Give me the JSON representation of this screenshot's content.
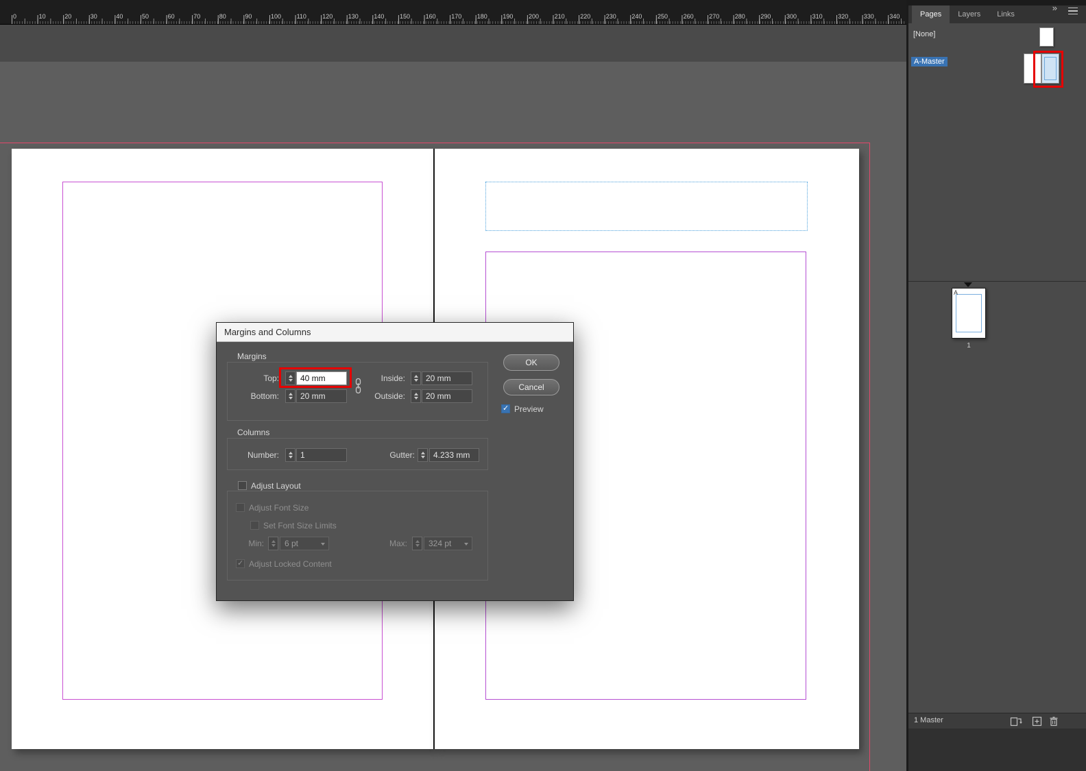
{
  "ruler": {
    "labels": [
      "0",
      "10",
      "20",
      "30",
      "40",
      "50",
      "60",
      "70",
      "80",
      "90",
      "100",
      "110",
      "120",
      "130",
      "140",
      "150",
      "160",
      "170",
      "180",
      "190",
      "200",
      "210",
      "220",
      "230",
      "240",
      "250",
      "260",
      "270",
      "280",
      "290",
      "300",
      "310",
      "320",
      "330",
      "340"
    ]
  },
  "dialog": {
    "title": "Margins and Columns",
    "buttons": {
      "ok": "OK",
      "cancel": "Cancel"
    },
    "preview_label": "Preview",
    "margins": {
      "legend": "Margins",
      "top": {
        "label": "Top:",
        "value": "40 mm"
      },
      "bottom": {
        "label": "Bottom:",
        "value": "20 mm"
      },
      "inside": {
        "label": "Inside:",
        "value": "20 mm"
      },
      "outside": {
        "label": "Outside:",
        "value": "20 mm"
      }
    },
    "columns": {
      "legend": "Columns",
      "number": {
        "label": "Number:",
        "value": "1"
      },
      "gutter": {
        "label": "Gutter:",
        "value": "4.233 mm"
      }
    },
    "adjust": {
      "legend": "Adjust Layout",
      "adjust_font_size": "Adjust Font Size",
      "set_font_size_limits": "Set Font Size Limits",
      "min": {
        "label": "Min:",
        "value": "6 pt"
      },
      "max": {
        "label": "Max:",
        "value": "324 pt"
      },
      "adjust_locked_content": "Adjust Locked Content"
    }
  },
  "panel": {
    "tabs": [
      "Pages",
      "Layers",
      "Links"
    ],
    "expand_icon": "»",
    "none_item": "[None]",
    "master_item": "A-Master",
    "master_page_letter": "A",
    "page_number": "1",
    "footer_label": "1 Master"
  },
  "colors": {
    "accent_blue": "#3973b3",
    "annotation_red": "#e60000",
    "margin_guide": "#c84fd2",
    "bleed_guide": "#e3486b",
    "text_frame_guide": "#4aa0dc"
  }
}
